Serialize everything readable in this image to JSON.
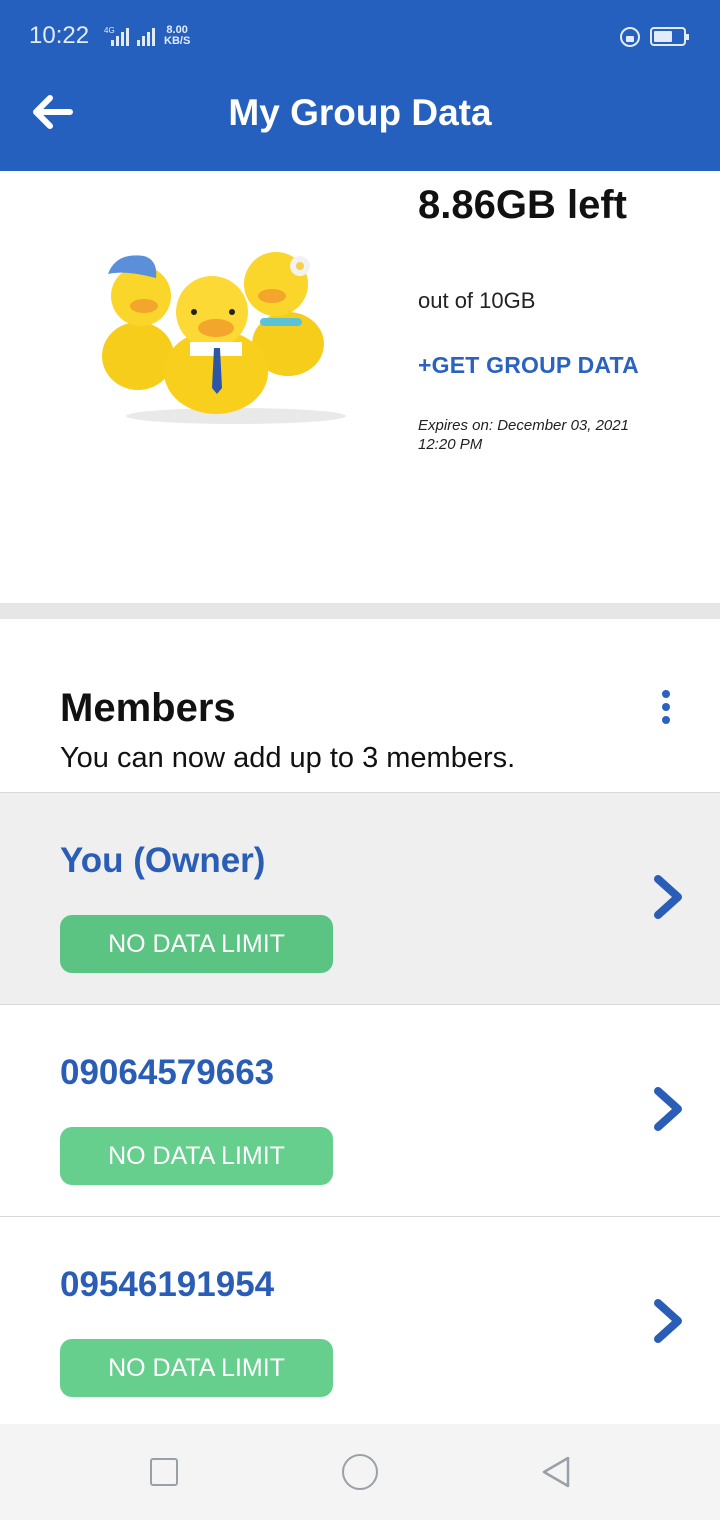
{
  "status_bar": {
    "time": "10:22",
    "network": "4G",
    "speed_value": "8.00",
    "speed_unit": "KB/S"
  },
  "app_bar": {
    "title": "My Group Data",
    "back_icon": "arrow-left-icon",
    "color": "#2660bf"
  },
  "summary": {
    "remaining": "8.86GB left",
    "total": "out of 10GB",
    "get_data_label": "+GET GROUP DATA",
    "expires": "Expires on: December 03, 2021 12:20 PM"
  },
  "members": {
    "title": "Members",
    "subtitle": "You can now add up to 3 members.",
    "menu_icon": "kebab-menu-icon",
    "items": [
      {
        "name": "You (Owner)",
        "badge": "NO DATA LIMIT"
      },
      {
        "name": "09064579663",
        "badge": "NO DATA LIMIT"
      },
      {
        "name": "09546191954",
        "badge": "NO DATA LIMIT"
      }
    ]
  },
  "colors": {
    "accent": "#2a62bf",
    "badge": "#67cf8e"
  },
  "nav_bar": {
    "icons": [
      "square-recents-icon",
      "circle-home-icon",
      "triangle-back-icon"
    ]
  }
}
